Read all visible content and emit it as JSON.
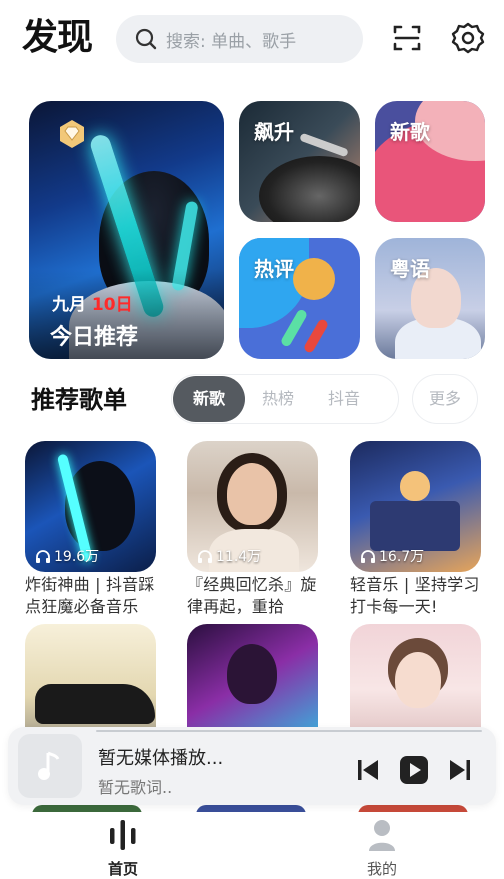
{
  "header": {
    "logo": "发现",
    "search_placeholder": "搜索: 单曲、歌手",
    "icons": [
      "search-icon",
      "scan-icon",
      "settings-gear-icon"
    ]
  },
  "featured": {
    "daily": {
      "month": "九月",
      "day": "10日",
      "title": "今日推荐",
      "badge": "vip-diamond-icon"
    },
    "tiles": [
      {
        "label": "飙升"
      },
      {
        "label": "新歌"
      },
      {
        "label": "热评"
      },
      {
        "label": "粤语"
      }
    ]
  },
  "section": {
    "title": "推荐歌单",
    "tabs": [
      "新歌",
      "热榜",
      "抖音"
    ],
    "active_tab": "新歌",
    "more": "更多"
  },
  "playlists": [
    {
      "plays": "19.6万",
      "name": "炸街神曲 | 抖音踩点狂魔必备音乐"
    },
    {
      "plays": "11.4万",
      "name": "『经典回忆杀』旋律再起，重拾"
    },
    {
      "plays": "16.7万",
      "name": "轻音乐 | 坚持学习打卡每一天!"
    },
    {
      "plays": "",
      "name": ""
    },
    {
      "plays": "",
      "name": ""
    },
    {
      "plays": "",
      "name": ""
    }
  ],
  "player": {
    "title": "暂无媒体播放...",
    "subtitle": "暂无歌词..",
    "controls": [
      "previous-icon",
      "play-icon",
      "next-icon"
    ]
  },
  "nav": {
    "items": [
      {
        "label": "首页",
        "icon": "home-bars-icon",
        "active": true
      },
      {
        "label": "我的",
        "icon": "profile-icon",
        "active": false
      }
    ]
  },
  "colors": {
    "accent_dark": "#555a60",
    "daily_red": "#ff2a2a",
    "muted": "#b5b9bf"
  }
}
